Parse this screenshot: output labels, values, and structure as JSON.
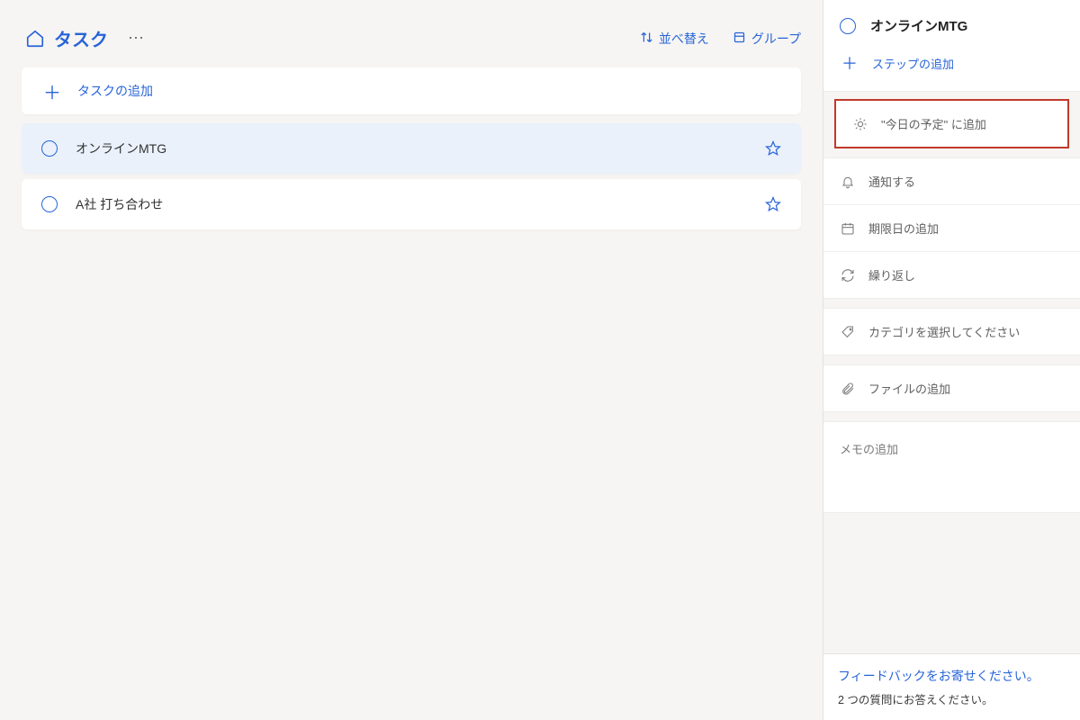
{
  "header": {
    "title": "タスク",
    "sort_label": "並べ替え",
    "group_label": "グループ"
  },
  "add_task": {
    "label": "タスクの追加"
  },
  "tasks": [
    {
      "title": "オンラインMTG",
      "selected": true
    },
    {
      "title": "A社  打ち合わせ",
      "selected": false
    }
  ],
  "detail": {
    "title": "オンラインMTG",
    "add_step": "ステップの追加",
    "add_to_myday": "\"今日の予定\" に追加",
    "remind": "通知する",
    "due": "期限日の追加",
    "repeat": "繰り返し",
    "category": "カテゴリを選択してください",
    "file": "ファイルの追加",
    "memo_placeholder": "メモの追加"
  },
  "feedback": {
    "title": "フィードバックをお寄せください。",
    "sub": "2 つの質問にお答えください。"
  }
}
